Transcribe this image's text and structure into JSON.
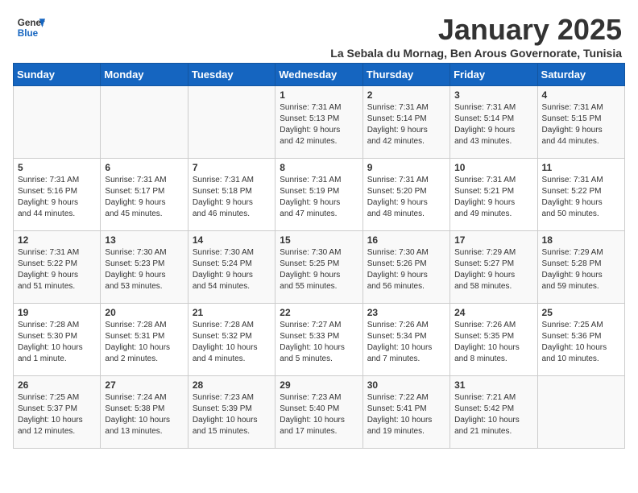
{
  "logo": {
    "line1": "General",
    "line2": "Blue"
  },
  "title": "January 2025",
  "subtitle": "La Sebala du Mornag, Ben Arous Governorate, Tunisia",
  "days_of_week": [
    "Sunday",
    "Monday",
    "Tuesday",
    "Wednesday",
    "Thursday",
    "Friday",
    "Saturday"
  ],
  "weeks": [
    [
      {
        "day": "",
        "info": ""
      },
      {
        "day": "",
        "info": ""
      },
      {
        "day": "",
        "info": ""
      },
      {
        "day": "1",
        "info": "Sunrise: 7:31 AM\nSunset: 5:13 PM\nDaylight: 9 hours\nand 42 minutes."
      },
      {
        "day": "2",
        "info": "Sunrise: 7:31 AM\nSunset: 5:14 PM\nDaylight: 9 hours\nand 42 minutes."
      },
      {
        "day": "3",
        "info": "Sunrise: 7:31 AM\nSunset: 5:14 PM\nDaylight: 9 hours\nand 43 minutes."
      },
      {
        "day": "4",
        "info": "Sunrise: 7:31 AM\nSunset: 5:15 PM\nDaylight: 9 hours\nand 44 minutes."
      }
    ],
    [
      {
        "day": "5",
        "info": "Sunrise: 7:31 AM\nSunset: 5:16 PM\nDaylight: 9 hours\nand 44 minutes."
      },
      {
        "day": "6",
        "info": "Sunrise: 7:31 AM\nSunset: 5:17 PM\nDaylight: 9 hours\nand 45 minutes."
      },
      {
        "day": "7",
        "info": "Sunrise: 7:31 AM\nSunset: 5:18 PM\nDaylight: 9 hours\nand 46 minutes."
      },
      {
        "day": "8",
        "info": "Sunrise: 7:31 AM\nSunset: 5:19 PM\nDaylight: 9 hours\nand 47 minutes."
      },
      {
        "day": "9",
        "info": "Sunrise: 7:31 AM\nSunset: 5:20 PM\nDaylight: 9 hours\nand 48 minutes."
      },
      {
        "day": "10",
        "info": "Sunrise: 7:31 AM\nSunset: 5:21 PM\nDaylight: 9 hours\nand 49 minutes."
      },
      {
        "day": "11",
        "info": "Sunrise: 7:31 AM\nSunset: 5:22 PM\nDaylight: 9 hours\nand 50 minutes."
      }
    ],
    [
      {
        "day": "12",
        "info": "Sunrise: 7:31 AM\nSunset: 5:22 PM\nDaylight: 9 hours\nand 51 minutes."
      },
      {
        "day": "13",
        "info": "Sunrise: 7:30 AM\nSunset: 5:23 PM\nDaylight: 9 hours\nand 53 minutes."
      },
      {
        "day": "14",
        "info": "Sunrise: 7:30 AM\nSunset: 5:24 PM\nDaylight: 9 hours\nand 54 minutes."
      },
      {
        "day": "15",
        "info": "Sunrise: 7:30 AM\nSunset: 5:25 PM\nDaylight: 9 hours\nand 55 minutes."
      },
      {
        "day": "16",
        "info": "Sunrise: 7:30 AM\nSunset: 5:26 PM\nDaylight: 9 hours\nand 56 minutes."
      },
      {
        "day": "17",
        "info": "Sunrise: 7:29 AM\nSunset: 5:27 PM\nDaylight: 9 hours\nand 58 minutes."
      },
      {
        "day": "18",
        "info": "Sunrise: 7:29 AM\nSunset: 5:28 PM\nDaylight: 9 hours\nand 59 minutes."
      }
    ],
    [
      {
        "day": "19",
        "info": "Sunrise: 7:28 AM\nSunset: 5:30 PM\nDaylight: 10 hours\nand 1 minute."
      },
      {
        "day": "20",
        "info": "Sunrise: 7:28 AM\nSunset: 5:31 PM\nDaylight: 10 hours\nand 2 minutes."
      },
      {
        "day": "21",
        "info": "Sunrise: 7:28 AM\nSunset: 5:32 PM\nDaylight: 10 hours\nand 4 minutes."
      },
      {
        "day": "22",
        "info": "Sunrise: 7:27 AM\nSunset: 5:33 PM\nDaylight: 10 hours\nand 5 minutes."
      },
      {
        "day": "23",
        "info": "Sunrise: 7:26 AM\nSunset: 5:34 PM\nDaylight: 10 hours\nand 7 minutes."
      },
      {
        "day": "24",
        "info": "Sunrise: 7:26 AM\nSunset: 5:35 PM\nDaylight: 10 hours\nand 8 minutes."
      },
      {
        "day": "25",
        "info": "Sunrise: 7:25 AM\nSunset: 5:36 PM\nDaylight: 10 hours\nand 10 minutes."
      }
    ],
    [
      {
        "day": "26",
        "info": "Sunrise: 7:25 AM\nSunset: 5:37 PM\nDaylight: 10 hours\nand 12 minutes."
      },
      {
        "day": "27",
        "info": "Sunrise: 7:24 AM\nSunset: 5:38 PM\nDaylight: 10 hours\nand 13 minutes."
      },
      {
        "day": "28",
        "info": "Sunrise: 7:23 AM\nSunset: 5:39 PM\nDaylight: 10 hours\nand 15 minutes."
      },
      {
        "day": "29",
        "info": "Sunrise: 7:23 AM\nSunset: 5:40 PM\nDaylight: 10 hours\nand 17 minutes."
      },
      {
        "day": "30",
        "info": "Sunrise: 7:22 AM\nSunset: 5:41 PM\nDaylight: 10 hours\nand 19 minutes."
      },
      {
        "day": "31",
        "info": "Sunrise: 7:21 AM\nSunset: 5:42 PM\nDaylight: 10 hours\nand 21 minutes."
      },
      {
        "day": "",
        "info": ""
      }
    ]
  ]
}
